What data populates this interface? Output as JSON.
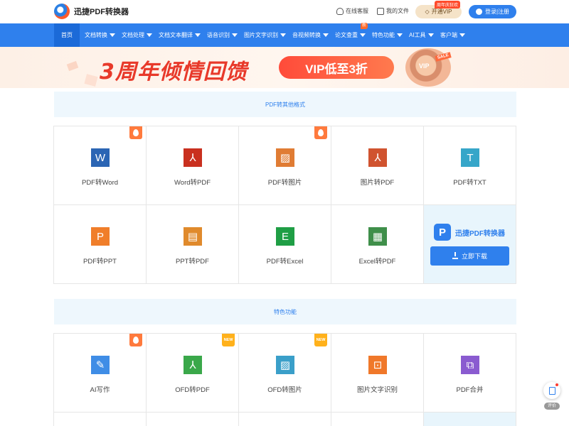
{
  "header": {
    "logo_text": "迅捷PDF转换器",
    "service_label": "在线客服",
    "files_label": "我的文件",
    "vip_label": "开通VIP",
    "vip_tag": "周年庆狂欢",
    "login_label": "登录|注册"
  },
  "nav": {
    "items": [
      {
        "label": "首页",
        "caret": false
      },
      {
        "label": "文档转换",
        "caret": true
      },
      {
        "label": "文档处理",
        "caret": true
      },
      {
        "label": "文档文本翻译",
        "caret": true
      },
      {
        "label": "语音识别",
        "caret": true
      },
      {
        "label": "图片文字识别",
        "caret": true
      },
      {
        "label": "音视频转换",
        "caret": true
      },
      {
        "label": "论文查重",
        "caret": true
      },
      {
        "label": "特色功能",
        "caret": true
      },
      {
        "label": "AI工具",
        "caret": true
      },
      {
        "label": "客户端",
        "caret": true
      }
    ],
    "new_badge": "新"
  },
  "banner": {
    "title": "3周年倾情回馈",
    "pill": "VIP低至3折",
    "coin_text": "VIP",
    "sale_text": "SALE"
  },
  "section1": {
    "title": "PDF转其他格式",
    "tools": [
      {
        "label": "PDF转Word",
        "icon": "word-icon",
        "glyph": "W",
        "color": "#2b65b4",
        "badge": "hot"
      },
      {
        "label": "Word转PDF",
        "icon": "pdf-icon",
        "glyph": "⅄",
        "color": "#c9301f",
        "badge": ""
      },
      {
        "label": "PDF转图片",
        "icon": "image-icon",
        "glyph": "▨",
        "color": "#e07c34",
        "badge": "hot"
      },
      {
        "label": "图片转PDF",
        "icon": "pdf-doc-icon",
        "glyph": "⅄",
        "color": "#d0532f",
        "badge": ""
      },
      {
        "label": "PDF转TXT",
        "icon": "txt-icon",
        "glyph": "T",
        "color": "#36a6c9",
        "badge": ""
      },
      {
        "label": "PDF转PPT",
        "icon": "ppt-icon",
        "glyph": "P",
        "color": "#f07e2a",
        "badge": ""
      },
      {
        "label": "PPT转PDF",
        "icon": "ppt-pdf-icon",
        "glyph": "▤",
        "color": "#e08a2c",
        "badge": ""
      },
      {
        "label": "PDF转Excel",
        "icon": "excel-icon",
        "glyph": "E",
        "color": "#1f9e45",
        "badge": ""
      }
    ],
    "excel_to_pdf": {
      "label": "Excel转PDF",
      "icon": "excel-pdf-icon",
      "glyph": "▦",
      "color": "#3f8f4a"
    },
    "promo": {
      "name": "迅捷PDF转换器",
      "logo_glyph": "P",
      "button": "立即下载"
    }
  },
  "section2": {
    "title": "特色功能",
    "tools": [
      {
        "label": "AI写作",
        "icon": "ai-write-icon",
        "glyph": "✎",
        "color": "#3f8de6",
        "badge": "hot"
      },
      {
        "label": "OFD转PDF",
        "icon": "ofd-pdf-icon",
        "glyph": "⅄",
        "color": "#3aa84a",
        "badge": "new"
      },
      {
        "label": "OFD转图片",
        "icon": "ofd-image-icon",
        "glyph": "▨",
        "color": "#3a9fc9",
        "badge": "new"
      },
      {
        "label": "图片文字识别",
        "icon": "ocr-icon",
        "glyph": "⊡",
        "color": "#f0782a",
        "badge": ""
      },
      {
        "label": "PDF合并",
        "icon": "merge-icon",
        "glyph": "⧉",
        "color": "#8a5bd0",
        "badge": ""
      }
    ],
    "new_text": "NEW"
  },
  "float": {
    "label": "评价"
  }
}
